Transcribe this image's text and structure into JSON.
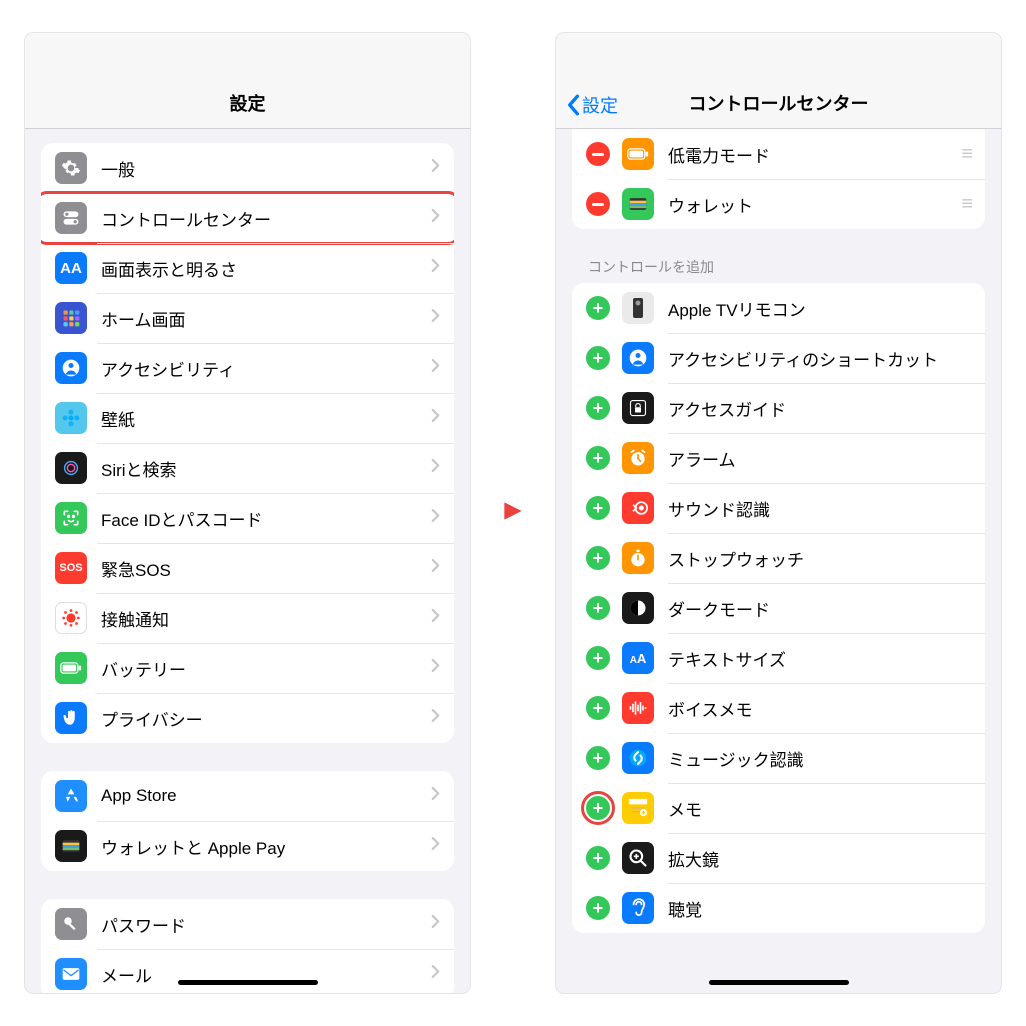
{
  "left": {
    "title": "設定",
    "groups": [
      {
        "items": [
          {
            "label": "一般",
            "icon": "gear",
            "bg": "#8e8e93"
          },
          {
            "label": "コントロールセンター",
            "icon": "toggles",
            "bg": "#8e8e93",
            "highlighted": true
          },
          {
            "label": "画面表示と明るさ",
            "icon": "AA",
            "bg": "#0a7aff"
          },
          {
            "label": "ホーム画面",
            "icon": "grid",
            "bg": "#3953d1"
          },
          {
            "label": "アクセシビリティ",
            "icon": "person",
            "bg": "#0a7aff"
          },
          {
            "label": "壁紙",
            "icon": "flower",
            "bg": "#54c7ec"
          },
          {
            "label": "Siriと検索",
            "icon": "siri",
            "bg": "#1a1a1a"
          },
          {
            "label": "Face IDとパスコード",
            "icon": "faceid",
            "bg": "#34c759"
          },
          {
            "label": "緊急SOS",
            "icon": "SOS",
            "bg": "#ff3b30"
          },
          {
            "label": "接触通知",
            "icon": "virus",
            "bg": "#ffffff"
          },
          {
            "label": "バッテリー",
            "icon": "battery",
            "bg": "#34c759"
          },
          {
            "label": "プライバシー",
            "icon": "hand",
            "bg": "#0a7aff"
          }
        ]
      },
      {
        "items": [
          {
            "label": "App Store",
            "icon": "appstore",
            "bg": "#1f8fff"
          },
          {
            "label": "ウォレットと Apple Pay",
            "icon": "wallet",
            "bg": "#1a1a1a"
          }
        ]
      },
      {
        "items": [
          {
            "label": "パスワード",
            "icon": "key",
            "bg": "#8e8e93"
          },
          {
            "label": "メール",
            "icon": "mail",
            "bg": "#1f8fff"
          }
        ]
      }
    ]
  },
  "right": {
    "back_label": "設定",
    "title": "コントロールセンター",
    "included": [
      {
        "label": "低電力モード",
        "icon": "battery",
        "bg": "#ff9500"
      },
      {
        "label": "ウォレット",
        "icon": "wallet",
        "bg": "#34c759"
      }
    ],
    "more_header": "コントロールを追加",
    "more": [
      {
        "label": "Apple TVリモコン",
        "icon": "remote",
        "bg": "#555"
      },
      {
        "label": "アクセシビリティのショートカット",
        "icon": "person",
        "bg": "#0a7aff"
      },
      {
        "label": "アクセスガイド",
        "icon": "lock",
        "bg": "#1a1a1a"
      },
      {
        "label": "アラーム",
        "icon": "alarm",
        "bg": "#ff9500"
      },
      {
        "label": "サウンド認識",
        "icon": "sound",
        "bg": "#ff3b30"
      },
      {
        "label": "ストップウォッチ",
        "icon": "stopwatch",
        "bg": "#ff9500"
      },
      {
        "label": "ダークモード",
        "icon": "darkmode",
        "bg": "#1a1a1a"
      },
      {
        "label": "テキストサイズ",
        "icon": "aA",
        "bg": "#0a7aff"
      },
      {
        "label": "ボイスメモ",
        "icon": "voice",
        "bg": "#ff3b30"
      },
      {
        "label": "ミュージック認識",
        "icon": "shazam",
        "bg": "#0a7aff"
      },
      {
        "label": "メモ",
        "icon": "notes",
        "bg": "#ffcc00",
        "highlighted": true
      },
      {
        "label": "拡大鏡",
        "icon": "magnifier",
        "bg": "#1a1a1a"
      },
      {
        "label": "聴覚",
        "icon": "ear",
        "bg": "#0a7aff"
      }
    ]
  }
}
